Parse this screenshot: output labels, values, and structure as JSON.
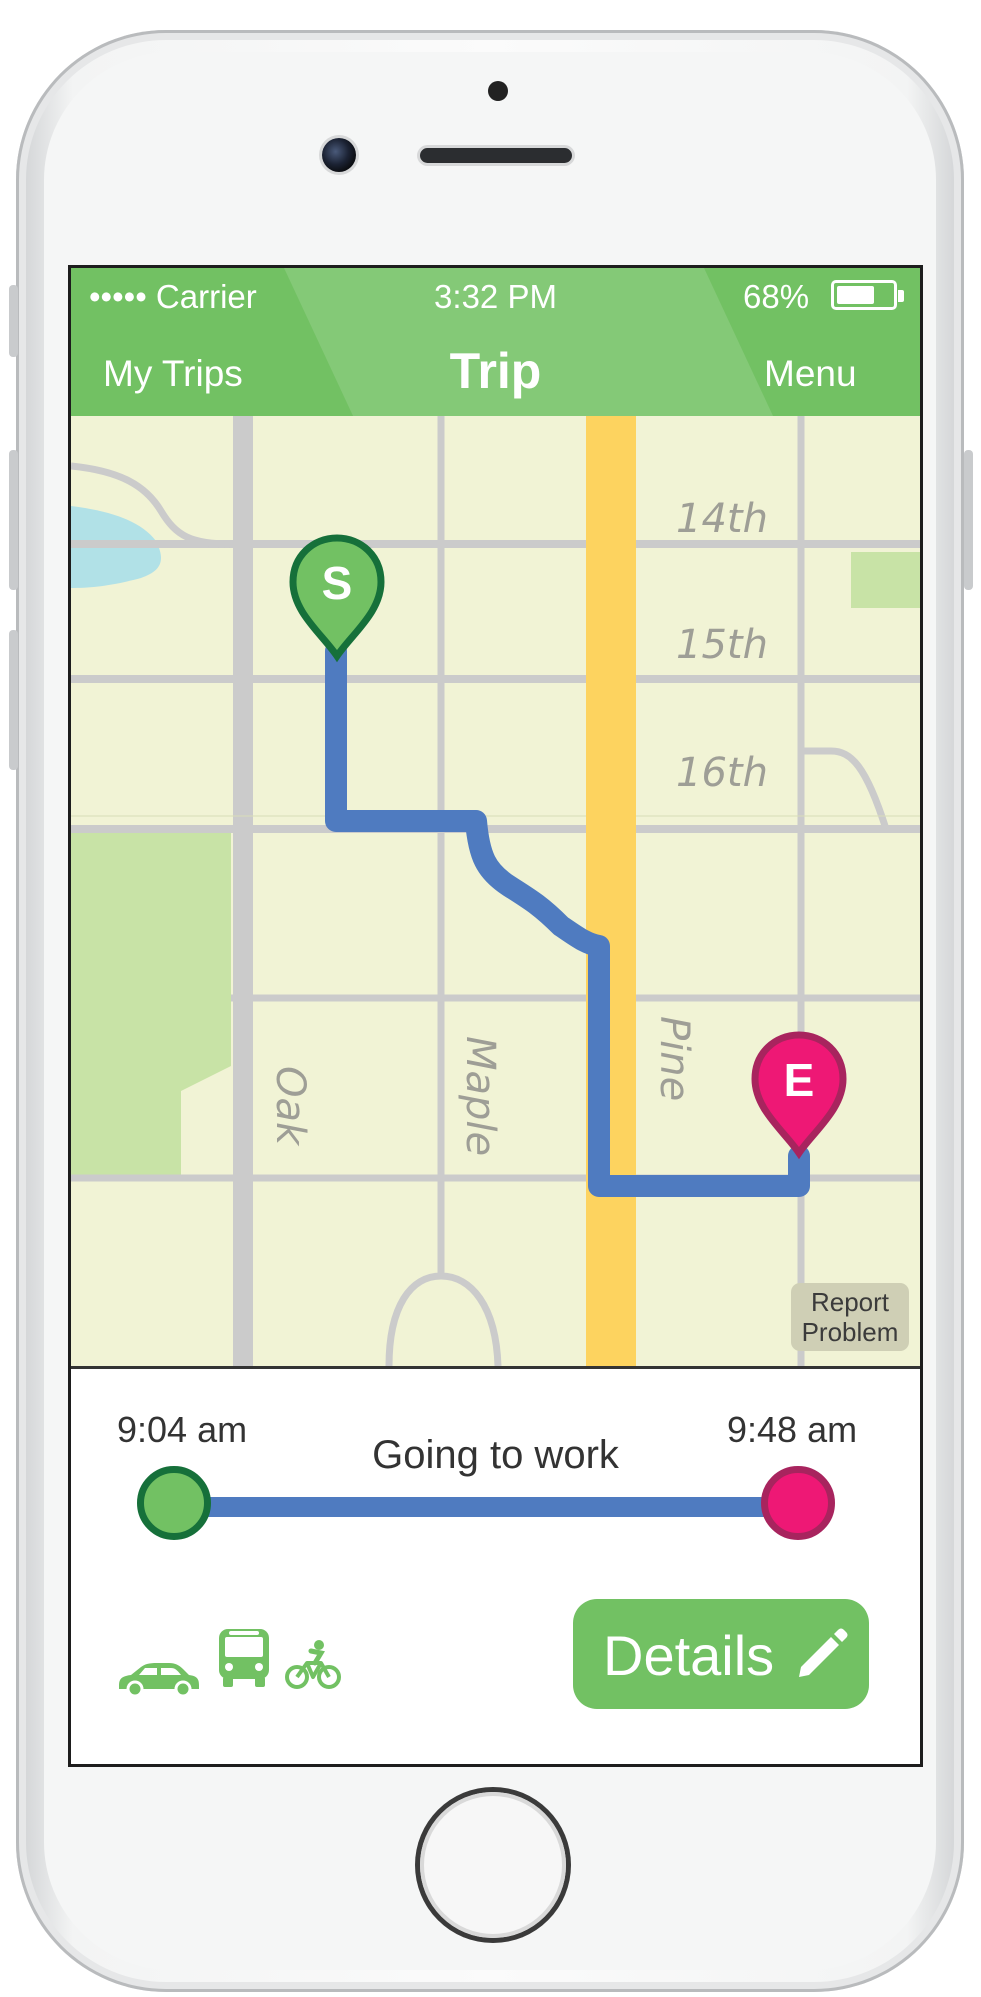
{
  "status_bar": {
    "carrier": "••••• Carrier",
    "time": "3:32 PM",
    "battery_percent": "68%",
    "battery_level": 0.68
  },
  "nav_bar": {
    "left_label": "My Trips",
    "title": "Trip",
    "right_label": "Menu"
  },
  "map": {
    "streets": {
      "s14": "14th",
      "s15": "15th",
      "s16": "16th",
      "oak": "Oak",
      "maple": "Maple",
      "pine": "Pine"
    },
    "start_pin_label": "S",
    "end_pin_label": "E",
    "report_problem": {
      "line1": "Report",
      "line2": "Problem"
    }
  },
  "trip": {
    "start_time": "9:04 am",
    "end_time": "9:48 am",
    "name": "Going to work"
  },
  "modes": [
    "car-icon",
    "bus-icon",
    "bicycle-icon"
  ],
  "details_button": {
    "label": "Details"
  },
  "colors": {
    "accent": "#72c163",
    "route": "#4f7bc0",
    "end": "#ee1875",
    "start_ring": "#16703a",
    "major_road": "#fdd35f"
  }
}
